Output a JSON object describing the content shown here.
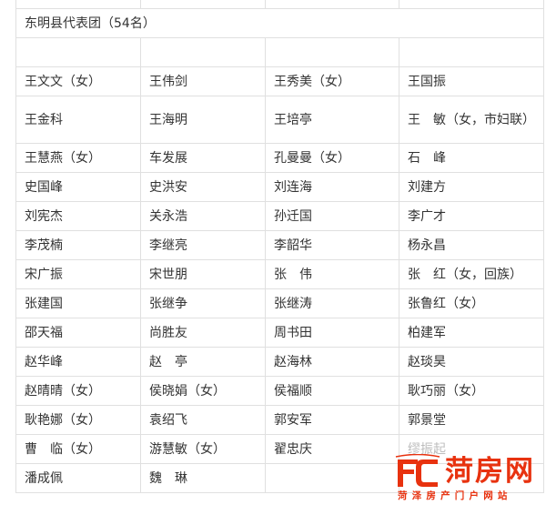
{
  "delegation": {
    "title": "东明县代表团（54名）",
    "rows": [
      [
        "王文文（女）",
        "王伟剑",
        "王秀美（女）",
        "王国振"
      ],
      [
        "王金科",
        "王海明",
        "王培亭",
        "王　敏（女，市妇联）"
      ],
      [
        "王慧燕（女）",
        "车发展",
        "孔曼曼（女）",
        "石　峰"
      ],
      [
        "史国峰",
        "史洪安",
        "刘连海",
        "刘建方"
      ],
      [
        "刘宪杰",
        "关永浩",
        "孙迁国",
        "李广才"
      ],
      [
        "李茂楠",
        "李继亮",
        "李韶华",
        "杨永昌"
      ],
      [
        "宋广振",
        "宋世朋",
        "张　伟",
        "张　红（女，回族）"
      ],
      [
        "张建国",
        "张继争",
        "张继涛",
        "张鲁红（女）"
      ],
      [
        "邵天福",
        "尚胜友",
        "周书田",
        "柏建军"
      ],
      [
        "赵华峰",
        "赵　亭",
        "赵海林",
        "赵琰昊"
      ],
      [
        "赵晴晴（女）",
        "侯晓娟（女）",
        "侯福顺",
        "耿巧丽（女）"
      ],
      [
        "耿艳娜（女）",
        "袁绍飞",
        "郭安军",
        "郭景堂"
      ],
      [
        "曹　临（女）",
        "游慧敏（女）",
        "翟忠庆",
        "缪振起"
      ],
      [
        "潘成佩",
        "魏　琳",
        "",
        ""
      ]
    ]
  },
  "watermark": {
    "brand": "菏房网",
    "subtitle": "菏泽房产门户网站",
    "color": "#e8320f",
    "icon": "fc-logo-mark"
  }
}
